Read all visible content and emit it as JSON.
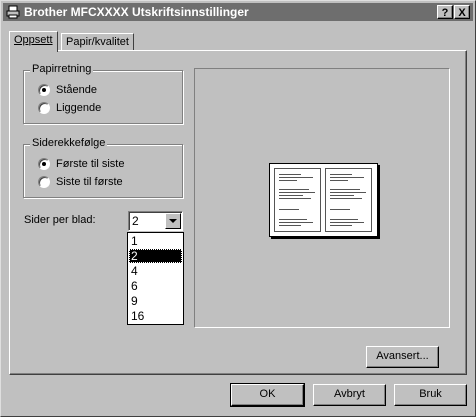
{
  "window": {
    "title": "Brother MFCXXXX Utskriftsinnstillinger",
    "help_button": "?",
    "close_button": "X"
  },
  "tabs": [
    {
      "label": "Oppsett",
      "active": true
    },
    {
      "label": "Papir/kvalitet",
      "active": false
    }
  ],
  "orientation": {
    "title": "Papirretning",
    "options": [
      {
        "label": "Stående",
        "accel": "t",
        "selected": true
      },
      {
        "label": "Liggende",
        "accel": "L",
        "selected": false
      }
    ]
  },
  "page_order": {
    "title": "Siderekkefølge",
    "options": [
      {
        "label": "Første til siste",
        "accel": "F",
        "selected": true
      },
      {
        "label": "Siste til første",
        "accel": "t",
        "selected": false
      }
    ]
  },
  "pages_per_sheet": {
    "label": "Sider per blad:",
    "value": "2",
    "options": [
      "1",
      "2",
      "4",
      "6",
      "9",
      "16"
    ],
    "selected_index": 1
  },
  "buttons": {
    "advanced": "Avansert...",
    "ok": "OK",
    "cancel": "Avbryt",
    "apply": "Bruk"
  }
}
